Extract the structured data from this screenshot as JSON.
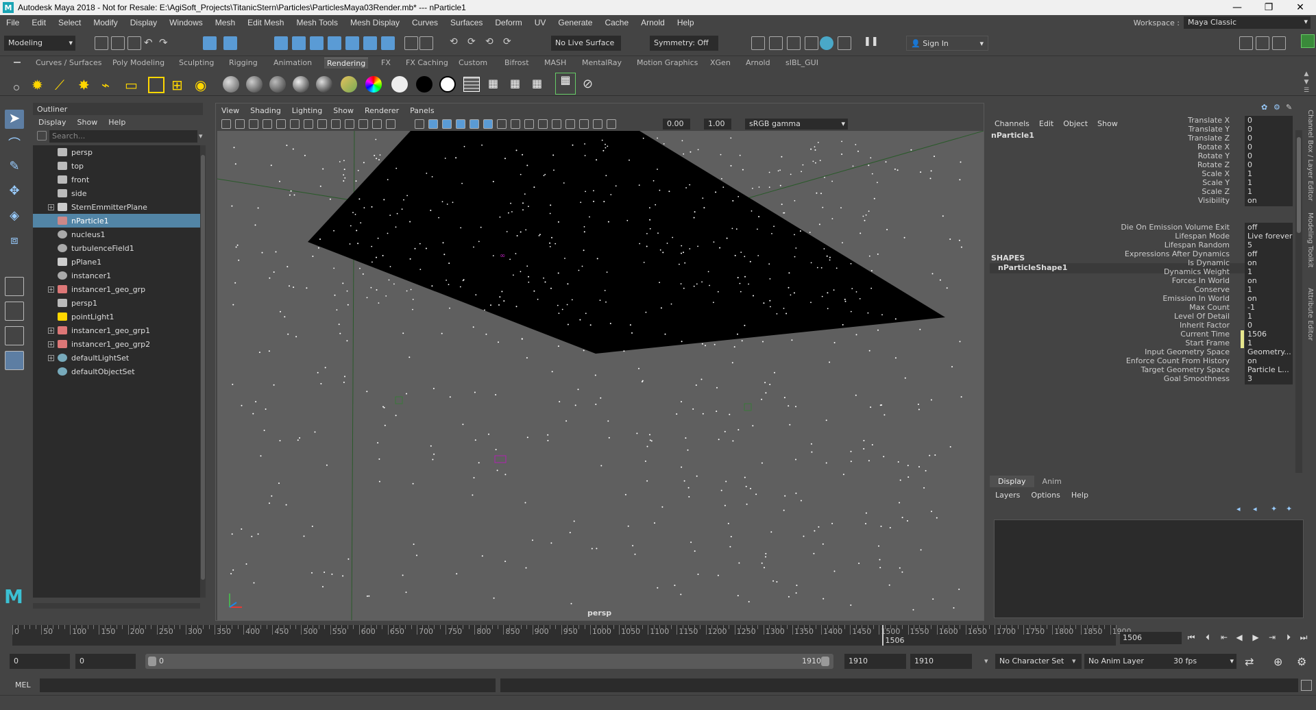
{
  "titlebar": {
    "title": "Autodesk Maya 2018 - Not for Resale: E:\\AgiSoft_Projects\\TitanicStern\\Particles\\ParticlesMaya03Render.mb*   ---   nParticle1",
    "logo": "M",
    "minimize": "—",
    "restore": "❐",
    "close": "✕"
  },
  "menubar": {
    "items": [
      "File",
      "Edit",
      "Select",
      "Modify",
      "Display",
      "Windows",
      "Mesh",
      "Edit Mesh",
      "Mesh Tools",
      "Mesh Display",
      "Curves",
      "Surfaces",
      "Deform",
      "UV",
      "Generate",
      "Cache",
      "Arnold",
      "Help"
    ],
    "workspace_label": "Workspace :",
    "workspace_value": "Maya Classic"
  },
  "statusline": {
    "menuset": "Modeling",
    "live_surface": "No Live Surface",
    "symmetry": "Symmetry: Off",
    "sign_in": "Sign In"
  },
  "shelf": {
    "tabs": [
      "Curves / Surfaces",
      "Poly Modeling",
      "Sculpting",
      "Rigging",
      "Animation",
      "Rendering",
      "FX",
      "FX Caching",
      "Custom",
      "Bifrost",
      "MASH",
      "MentalRay",
      "Motion Graphics",
      "XGen",
      "Arnold",
      "sIBL_GUI"
    ],
    "active_tab": "Rendering"
  },
  "outliner": {
    "title": "Outliner",
    "menus": [
      "Display",
      "Show",
      "Help"
    ],
    "search_placeholder": "Search...",
    "items": [
      {
        "label": "persp",
        "icon": "camera-icon",
        "expandable": false,
        "selected": false
      },
      {
        "label": "top",
        "icon": "camera-icon",
        "expandable": false,
        "selected": false
      },
      {
        "label": "front",
        "icon": "camera-icon",
        "expandable": false,
        "selected": false
      },
      {
        "label": "side",
        "icon": "camera-icon",
        "expandable": false,
        "selected": false
      },
      {
        "label": "SternEmmitterPlane",
        "icon": "mesh-icon",
        "expandable": true,
        "selected": false
      },
      {
        "label": "nParticle1",
        "icon": "nparticle-icon",
        "expandable": false,
        "selected": true
      },
      {
        "label": "nucleus1",
        "icon": "nucleus-icon",
        "expandable": false,
        "selected": false
      },
      {
        "label": "turbulenceField1",
        "icon": "field-icon",
        "expandable": false,
        "selected": false
      },
      {
        "label": "pPlane1",
        "icon": "mesh-icon",
        "expandable": false,
        "selected": false
      },
      {
        "label": "instancer1",
        "icon": "instancer-icon",
        "expandable": false,
        "selected": false
      },
      {
        "label": "instancer1_geo_grp",
        "icon": "group-icon",
        "expandable": true,
        "selected": false
      },
      {
        "label": "persp1",
        "icon": "camera-icon",
        "expandable": false,
        "selected": false
      },
      {
        "label": "pointLight1",
        "icon": "light-icon",
        "expandable": false,
        "selected": false
      },
      {
        "label": "instancer1_geo_grp1",
        "icon": "group-icon",
        "expandable": true,
        "selected": false
      },
      {
        "label": "instancer1_geo_grp2",
        "icon": "group-icon",
        "expandable": true,
        "selected": false
      },
      {
        "label": "defaultLightSet",
        "icon": "set-icon",
        "expandable": true,
        "selected": false
      },
      {
        "label": "defaultObjectSet",
        "icon": "set-icon",
        "expandable": false,
        "selected": false
      }
    ]
  },
  "viewport": {
    "menus": [
      "View",
      "Shading",
      "Lighting",
      "Show",
      "Renderer",
      "Panels"
    ],
    "near_value": "0.00",
    "far_value": "1.00",
    "color_space": "sRGB gamma",
    "camera_label": "persp"
  },
  "channelbox": {
    "menus": [
      "Channels",
      "Edit",
      "Object",
      "Show"
    ],
    "object_name": "nParticle1",
    "transform_attrs": [
      {
        "name": "Translate X",
        "value": "0"
      },
      {
        "name": "Translate Y",
        "value": "0"
      },
      {
        "name": "Translate Z",
        "value": "0"
      },
      {
        "name": "Rotate X",
        "value": "0"
      },
      {
        "name": "Rotate Y",
        "value": "0"
      },
      {
        "name": "Rotate Z",
        "value": "0"
      },
      {
        "name": "Scale X",
        "value": "1"
      },
      {
        "name": "Scale Y",
        "value": "1"
      },
      {
        "name": "Scale Z",
        "value": "1"
      },
      {
        "name": "Visibility",
        "value": "on"
      }
    ],
    "shapes_header": "SHAPES",
    "shape_name": "nParticleShape1",
    "shape_attrs": [
      {
        "name": "Die On Emission Volume Exit",
        "value": "off"
      },
      {
        "name": "Lifespan Mode",
        "value": "Live forever"
      },
      {
        "name": "Lifespan Random",
        "value": "5"
      },
      {
        "name": "Expressions After Dynamics",
        "value": "off"
      },
      {
        "name": "Is Dynamic",
        "value": "on"
      },
      {
        "name": "Dynamics Weight",
        "value": "1"
      },
      {
        "name": "Forces In World",
        "value": "on"
      },
      {
        "name": "Conserve",
        "value": "1"
      },
      {
        "name": "Emission In World",
        "value": "on"
      },
      {
        "name": "Max Count",
        "value": "-1"
      },
      {
        "name": "Level Of Detail",
        "value": "1"
      },
      {
        "name": "Inherit Factor",
        "value": "0"
      },
      {
        "name": "Current Time",
        "value": "1506",
        "keyed": true
      },
      {
        "name": "Start Frame",
        "value": "1",
        "keyed": true
      },
      {
        "name": "Input Geometry Space",
        "value": "Geometry..."
      },
      {
        "name": "Enforce Count From History",
        "value": "on"
      },
      {
        "name": "Target Geometry Space",
        "value": "Particle L..."
      },
      {
        "name": "Goal Smoothness",
        "value": "3"
      }
    ],
    "side_tabs": [
      "Channel Box / Layer Editor",
      "Modeling Toolkit",
      "Attribute Editor"
    ]
  },
  "layer_editor": {
    "tabs": [
      "Display",
      "Anim"
    ],
    "active_tab": "Display",
    "menus": [
      "Layers",
      "Options",
      "Help"
    ]
  },
  "timeslider": {
    "tick_labels": [
      "0",
      "50",
      "100",
      "150",
      "200",
      "250",
      "300",
      "350",
      "400",
      "450",
      "500",
      "550",
      "600",
      "650",
      "700",
      "750",
      "800",
      "850",
      "900",
      "950",
      "1000",
      "1050",
      "1100",
      "1150",
      "1200",
      "1250",
      "1300",
      "1350",
      "1400",
      "1450",
      "1500",
      "1550",
      "1600",
      "1650",
      "1700",
      "1750",
      "1800",
      "1850",
      "1900"
    ],
    "range_start": 0,
    "range_end": 1910,
    "current_frame": 1506,
    "current_frame_field": "1506"
  },
  "rangeslider": {
    "start": "0",
    "anim_start": "0",
    "handle_start": "0",
    "handle_end": "1910",
    "playback_end": "1910",
    "anim_end": "1910",
    "character_set": "No Character Set",
    "anim_layer": "No Anim Layer",
    "fps": "30 fps"
  },
  "cmdline": {
    "label": "MEL"
  },
  "colors": {
    "ui_bg": "#444444",
    "field_bg": "#2b2b2b",
    "selection": "#5285a6",
    "viewport_bg": "#5f5f5f",
    "particle": "#ffffff",
    "keyed": "#e6e68c"
  }
}
